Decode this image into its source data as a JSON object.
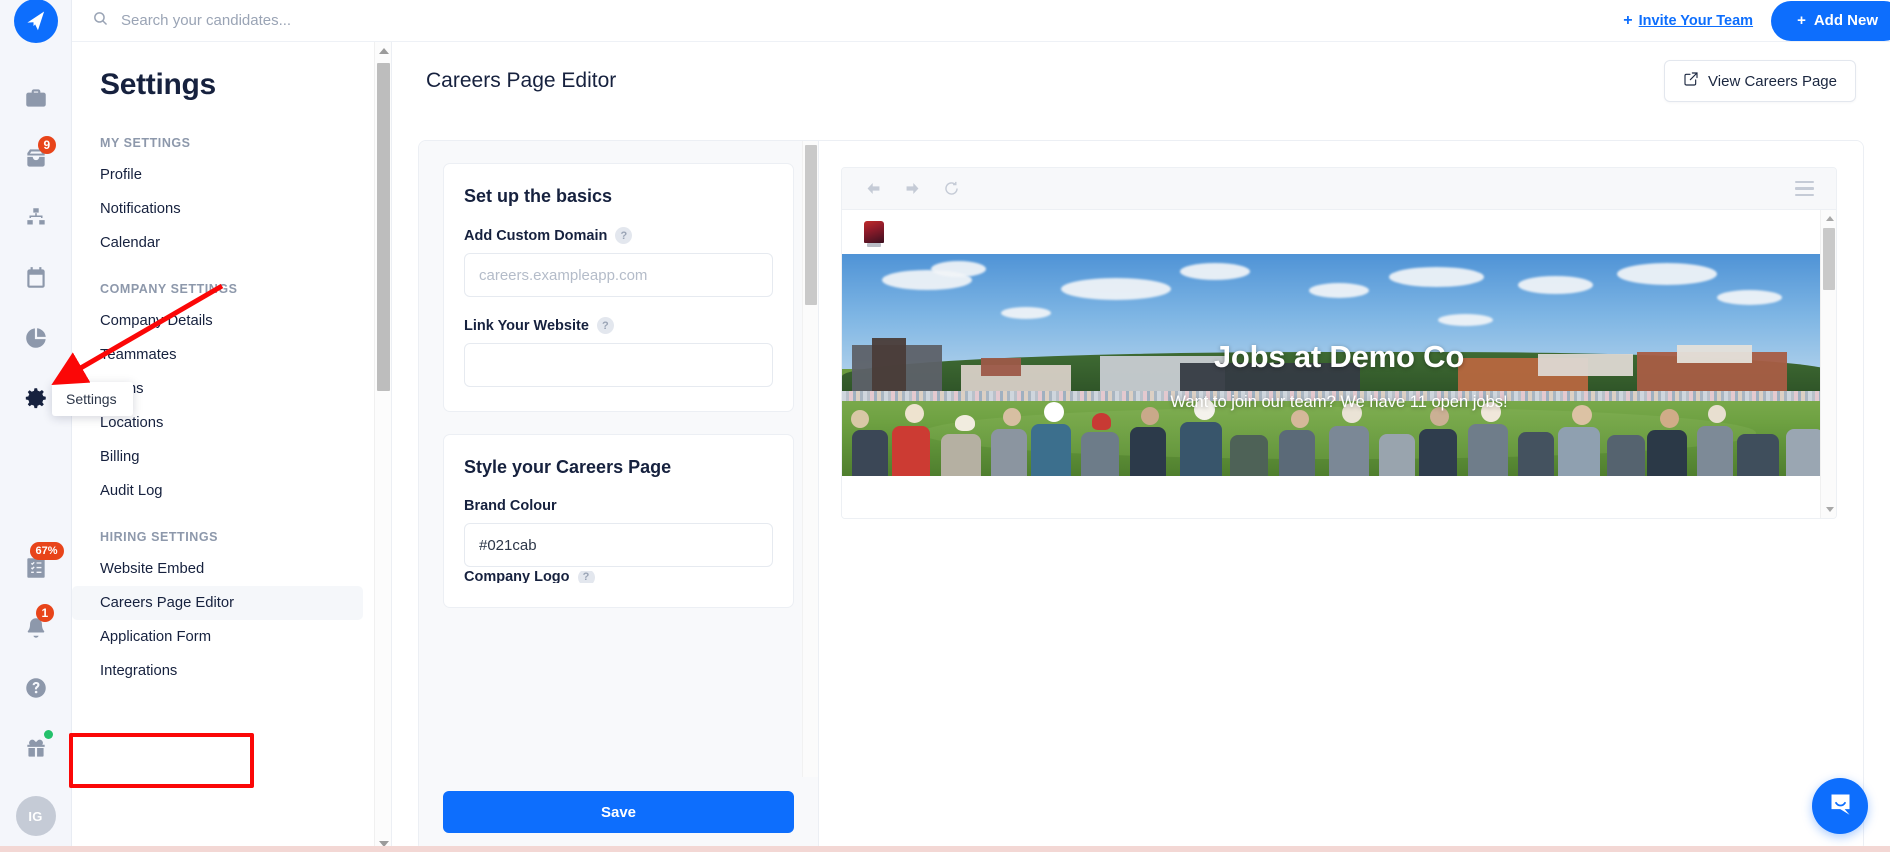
{
  "rail": {
    "logo_icon": "rocket-logo-icon",
    "items": [
      {
        "name": "jobs",
        "icon": "briefcase-icon",
        "badge": null
      },
      {
        "name": "inbox",
        "icon": "inbox-icon",
        "badge": "9"
      },
      {
        "name": "pipeline",
        "icon": "org-chart-icon",
        "badge": null
      },
      {
        "name": "calendar",
        "icon": "calendar-icon",
        "badge": null
      },
      {
        "name": "reports",
        "icon": "pie-chart-icon",
        "badge": null
      },
      {
        "name": "settings",
        "icon": "gear-icon",
        "badge": null
      },
      {
        "name": "tasks",
        "icon": "checklist-icon",
        "badge": "67%"
      },
      {
        "name": "notifications",
        "icon": "bell-icon",
        "badge": "1"
      },
      {
        "name": "help",
        "icon": "question-circle-icon",
        "badge": null
      },
      {
        "name": "gifts",
        "icon": "gift-icon",
        "badge": null
      }
    ],
    "avatar_initials": "IG",
    "tooltip": "Settings"
  },
  "topbar": {
    "search_placeholder": "Search your candidates...",
    "search_value": "",
    "invite_plus": "+",
    "invite_label": "Invite Your Team",
    "add_new_plus": "+",
    "add_new_label": "Add New"
  },
  "settings": {
    "title": "Settings",
    "groups": [
      {
        "label": "MY SETTINGS",
        "items": [
          {
            "label": "Profile",
            "selected": false
          },
          {
            "label": "Notifications",
            "selected": false
          },
          {
            "label": "Calendar",
            "selected": false
          }
        ]
      },
      {
        "label": "COMPANY SETTINGS",
        "items": [
          {
            "label": "Company Details",
            "selected": false
          },
          {
            "label": "Teammates",
            "selected": false
          },
          {
            "label": "Teams",
            "selected": false
          },
          {
            "label": "Locations",
            "selected": false
          },
          {
            "label": "Billing",
            "selected": false
          },
          {
            "label": "Audit Log",
            "selected": false
          }
        ]
      },
      {
        "label": "HIRING SETTINGS",
        "items": [
          {
            "label": "Website Embed",
            "selected": false
          },
          {
            "label": "Careers Page Editor",
            "selected": true
          },
          {
            "label": "Application Form",
            "selected": false
          },
          {
            "label": "Integrations",
            "selected": false
          }
        ]
      }
    ]
  },
  "content": {
    "page_title": "Careers Page Editor",
    "view_button_label": "View Careers Page",
    "view_button_icon": "external-link-icon"
  },
  "form": {
    "basics": {
      "heading": "Set up the basics",
      "domain_label": "Add Custom Domain",
      "domain_placeholder": "careers.exampleapp.com",
      "domain_value": "",
      "website_label": "Link Your Website",
      "website_placeholder": "",
      "website_value": ""
    },
    "style": {
      "heading": "Style your Careers Page",
      "brand_colour_label": "Brand Colour",
      "brand_colour_value": "#021cab",
      "next_label_partial": "Company Logo"
    },
    "save_label": "Save"
  },
  "preview": {
    "browser": {
      "back_icon": "arrow-left-icon",
      "forward_icon": "arrow-right-icon",
      "reload_icon": "reload-icon",
      "menu_icon": "hamburger-menu-icon"
    },
    "site_logo_icon": "company-logo-icon",
    "hero_heading": "Jobs at Demo Co",
    "hero_subheading": "Want to join our team? We have 11 open jobs!"
  },
  "widgets": {
    "intercom_icon": "chat-bubble-icon"
  },
  "colors": {
    "accent": "#0d6efd",
    "badge_red": "#e8441a",
    "annotation_red": "#fb0707",
    "text_dark": "#16213e",
    "muted": "#8d98ab",
    "brand_colour": "#021cab"
  }
}
